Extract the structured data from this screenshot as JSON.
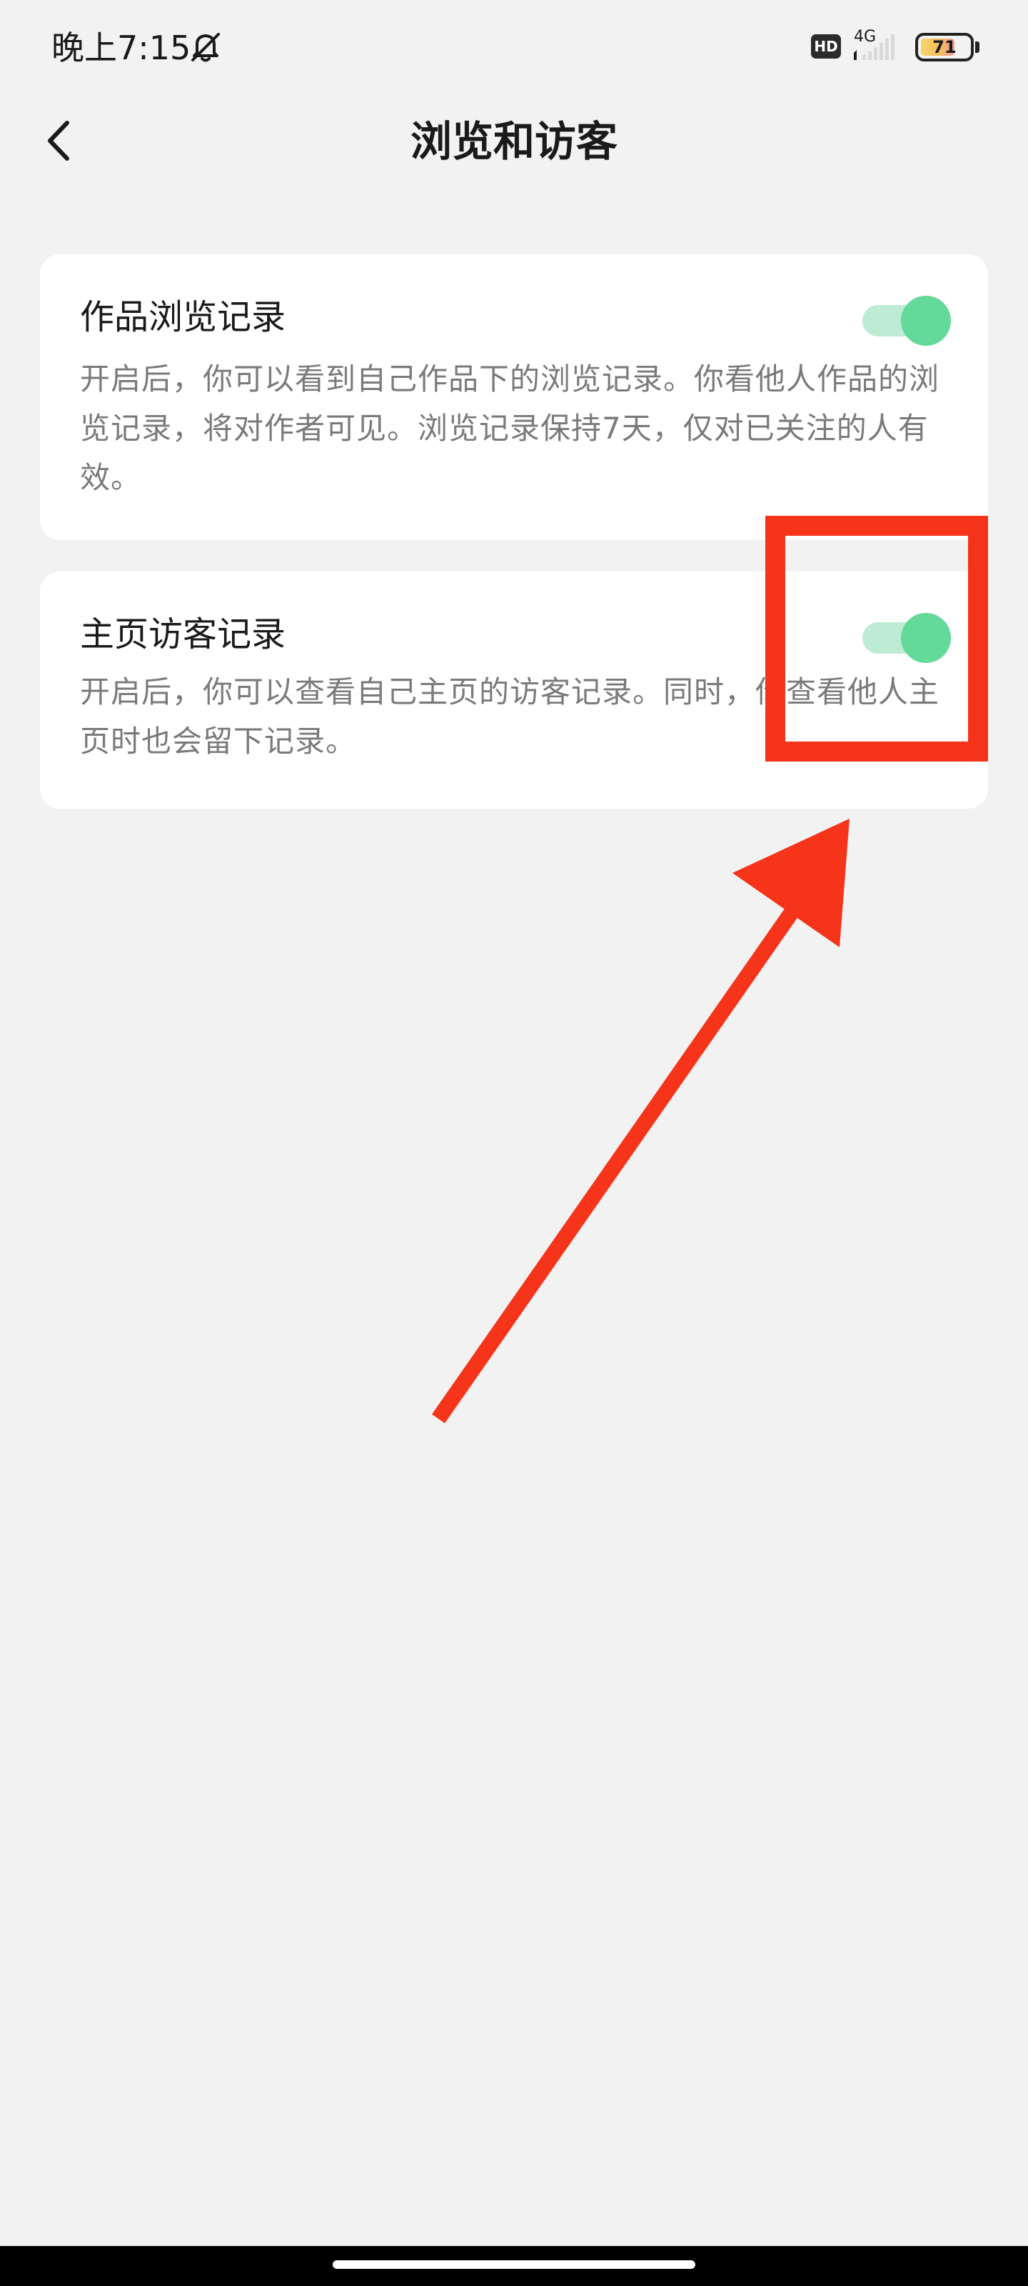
{
  "status_bar": {
    "time": "晚上7:15",
    "hd_badge": "HD",
    "network": "4G",
    "battery_level": "71",
    "battery_percent": 71
  },
  "header": {
    "title": "浏览和访客"
  },
  "settings": [
    {
      "title": "作品浏览记录",
      "description": "开启后，你可以看到自己作品下的浏览记录。你看他人作品的浏览记录，将对作者可见。浏览记录保持7天，仅对已关注的人有效。",
      "enabled": true
    },
    {
      "title": "主页访客记录",
      "description": "开启后，你可以查看自己主页的访客记录。同时，你查看他人主页时也会留下记录。",
      "enabled": true
    }
  ],
  "colors": {
    "toggle_on": "#63d99a",
    "toggle_track_on": "#bdebd3",
    "annotation": "#f5341a",
    "background": "#f2f2f2"
  }
}
